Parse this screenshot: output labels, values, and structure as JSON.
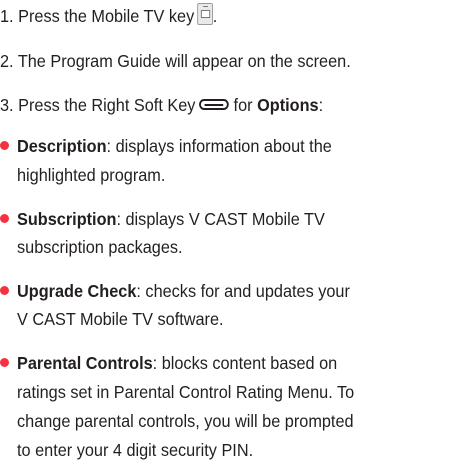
{
  "steps": [
    {
      "number": "1.",
      "text": "Press the Mobile TV key",
      "icon": "mobile-tv-key-icon"
    },
    {
      "number": "2.",
      "text": "The Program Guide will appear on the screen."
    },
    {
      "number": "3.",
      "text_before": "Press the Right Soft Key",
      "icon": "right-soft-key-icon",
      "text_mid": "for",
      "bold": "Options",
      "text_after": ":"
    }
  ],
  "options": [
    {
      "term": "Description",
      "lines": [
        ": displays information about the",
        "highlighted program."
      ]
    },
    {
      "term": "Subscription",
      "lines": [
        ": displays V CAST Mobile TV",
        "subscription packages."
      ]
    },
    {
      "term": "Upgrade Check",
      "lines": [
        ": checks for and updates your",
        "V CAST Mobile TV software."
      ]
    },
    {
      "term": "Parental Controls",
      "lines": [
        ": blocks content based on",
        "ratings set in Parental Control Rating Menu. To",
        "change parental controls, you will be prompted",
        "to enter your 4 digit security PIN."
      ]
    }
  ],
  "colors": {
    "bullet": "#f5333f",
    "text": "#231f20"
  }
}
